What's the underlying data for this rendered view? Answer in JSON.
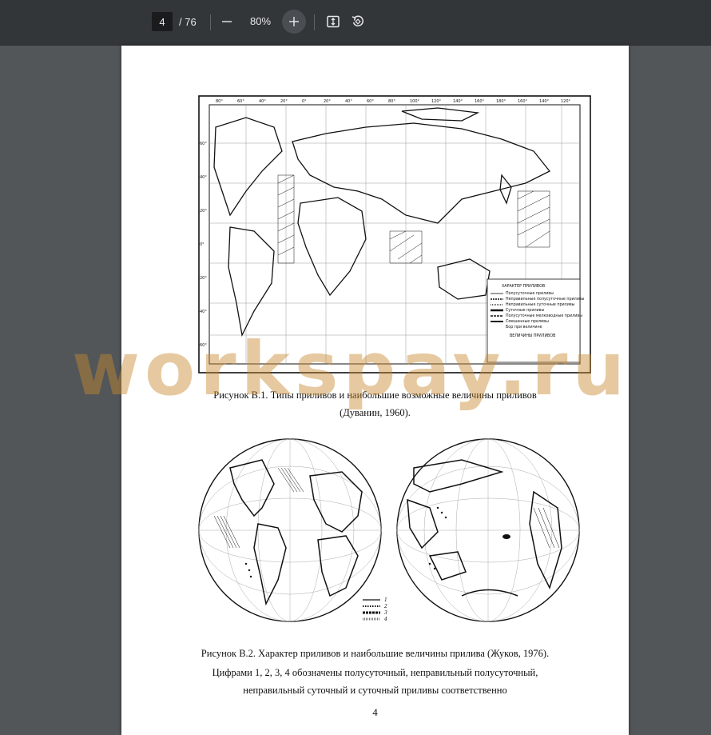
{
  "toolbar": {
    "page_current": "4",
    "page_total": "/ 76",
    "zoom": "80%"
  },
  "figure1": {
    "longitudes_top": [
      "80°",
      "60°",
      "40°",
      "20°",
      "0°",
      "20°",
      "40°",
      "60°",
      "80°",
      "100°",
      "120°",
      "140°",
      "160°",
      "180°",
      "160°",
      "140°",
      "120°"
    ],
    "latitudes_left": [
      "60°",
      "40°",
      "20°",
      "0°",
      "20°",
      "40°",
      "60°"
    ],
    "legend_title": "ХАРАКТЕР ПРИЛИВОВ",
    "legend_items": [
      "Полусуточные приливы",
      "Неправильные полусуточные приливы",
      "Неправильные суточные приливы",
      "Суточные приливы",
      "Полусуточные мелководные приливы",
      "Смешанные приливы",
      "Бор при величине"
    ],
    "legend_side": "смешанные приливы",
    "legend_title2": "ВЕЛИЧИНЫ ПРИЛИВОВ"
  },
  "figure2": {
    "legend_numbers": [
      "1",
      "2",
      "3",
      "4"
    ]
  },
  "captions": {
    "fig1_line1": "Рисунок В.1. Типы приливов и наибольшие возможные величины приливов",
    "fig1_line2": "(Дуванин, 1960).",
    "fig2_line1": "Рисунок В.2. Характер приливов и наибольшие величины прилива (Жуков, 1976).",
    "fig2_line2": "Цифрами 1, 2, 3, 4 обозначены полусуточный, неправильный полусуточный,",
    "fig2_line3": "неправильный суточный и суточный приливы соответственно"
  },
  "page_number": "4",
  "watermark": "workspay.ru",
  "colors": {
    "toolbar": "#323639",
    "viewer_bg": "#525659",
    "watermark": "#c9892e"
  }
}
